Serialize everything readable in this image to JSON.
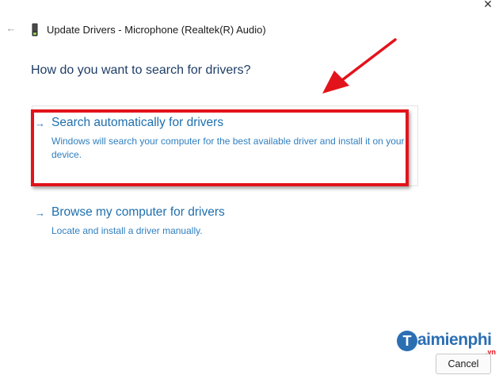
{
  "window": {
    "title": "Update Drivers - Microphone (Realtek(R) Audio)",
    "back_icon": "back-arrow-icon",
    "close_icon": "close-icon",
    "close_glyph": "✕",
    "back_glyph": "←"
  },
  "page": {
    "heading": "How do you want to search for drivers?"
  },
  "options": [
    {
      "arrow": "→",
      "title": "Search automatically for drivers",
      "description": "Windows will search your computer for the best available driver and install it on your device."
    },
    {
      "arrow": "→",
      "title": "Browse my computer for drivers",
      "description": "Locate and install a driver manually."
    }
  ],
  "watermark": {
    "initial": "T",
    "text": "aimienphi",
    "suffix": ".vn"
  },
  "footer": {
    "cancel_label": "Cancel"
  },
  "colors": {
    "accent": "#1e6fae",
    "heading": "#1e3d66",
    "annotation_red": "#e3131b"
  }
}
